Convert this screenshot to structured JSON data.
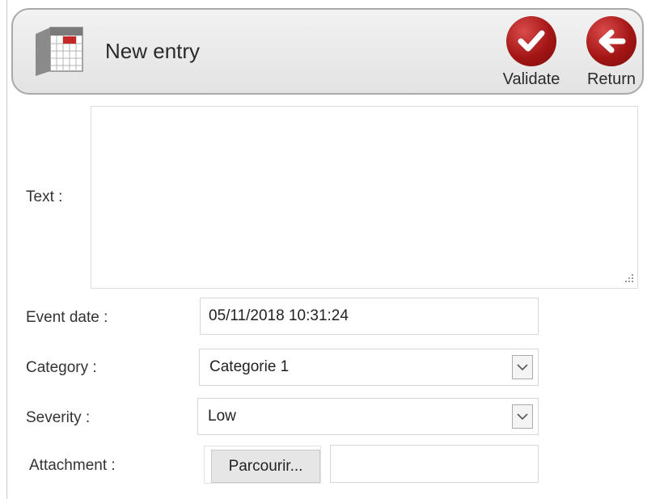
{
  "header": {
    "title": "New entry",
    "icon": "calendar-icon",
    "actions": {
      "validate_label": "Validate",
      "return_label": "Return"
    }
  },
  "form": {
    "text": {
      "label": "Text :",
      "value": ""
    },
    "event_date": {
      "label": "Event date :",
      "value": "05/11/2018 10:31:24"
    },
    "category": {
      "label": "Category :",
      "selected": "Categorie 1"
    },
    "severity": {
      "label": "Severity :",
      "selected": "Low"
    },
    "attachment": {
      "label": "Attachment :",
      "browse_label": "Parcourir...",
      "file_name": ""
    }
  },
  "colors": {
    "accent": "#a41515",
    "header_bg": "#e8e8e8",
    "border": "#d7d7d7"
  }
}
